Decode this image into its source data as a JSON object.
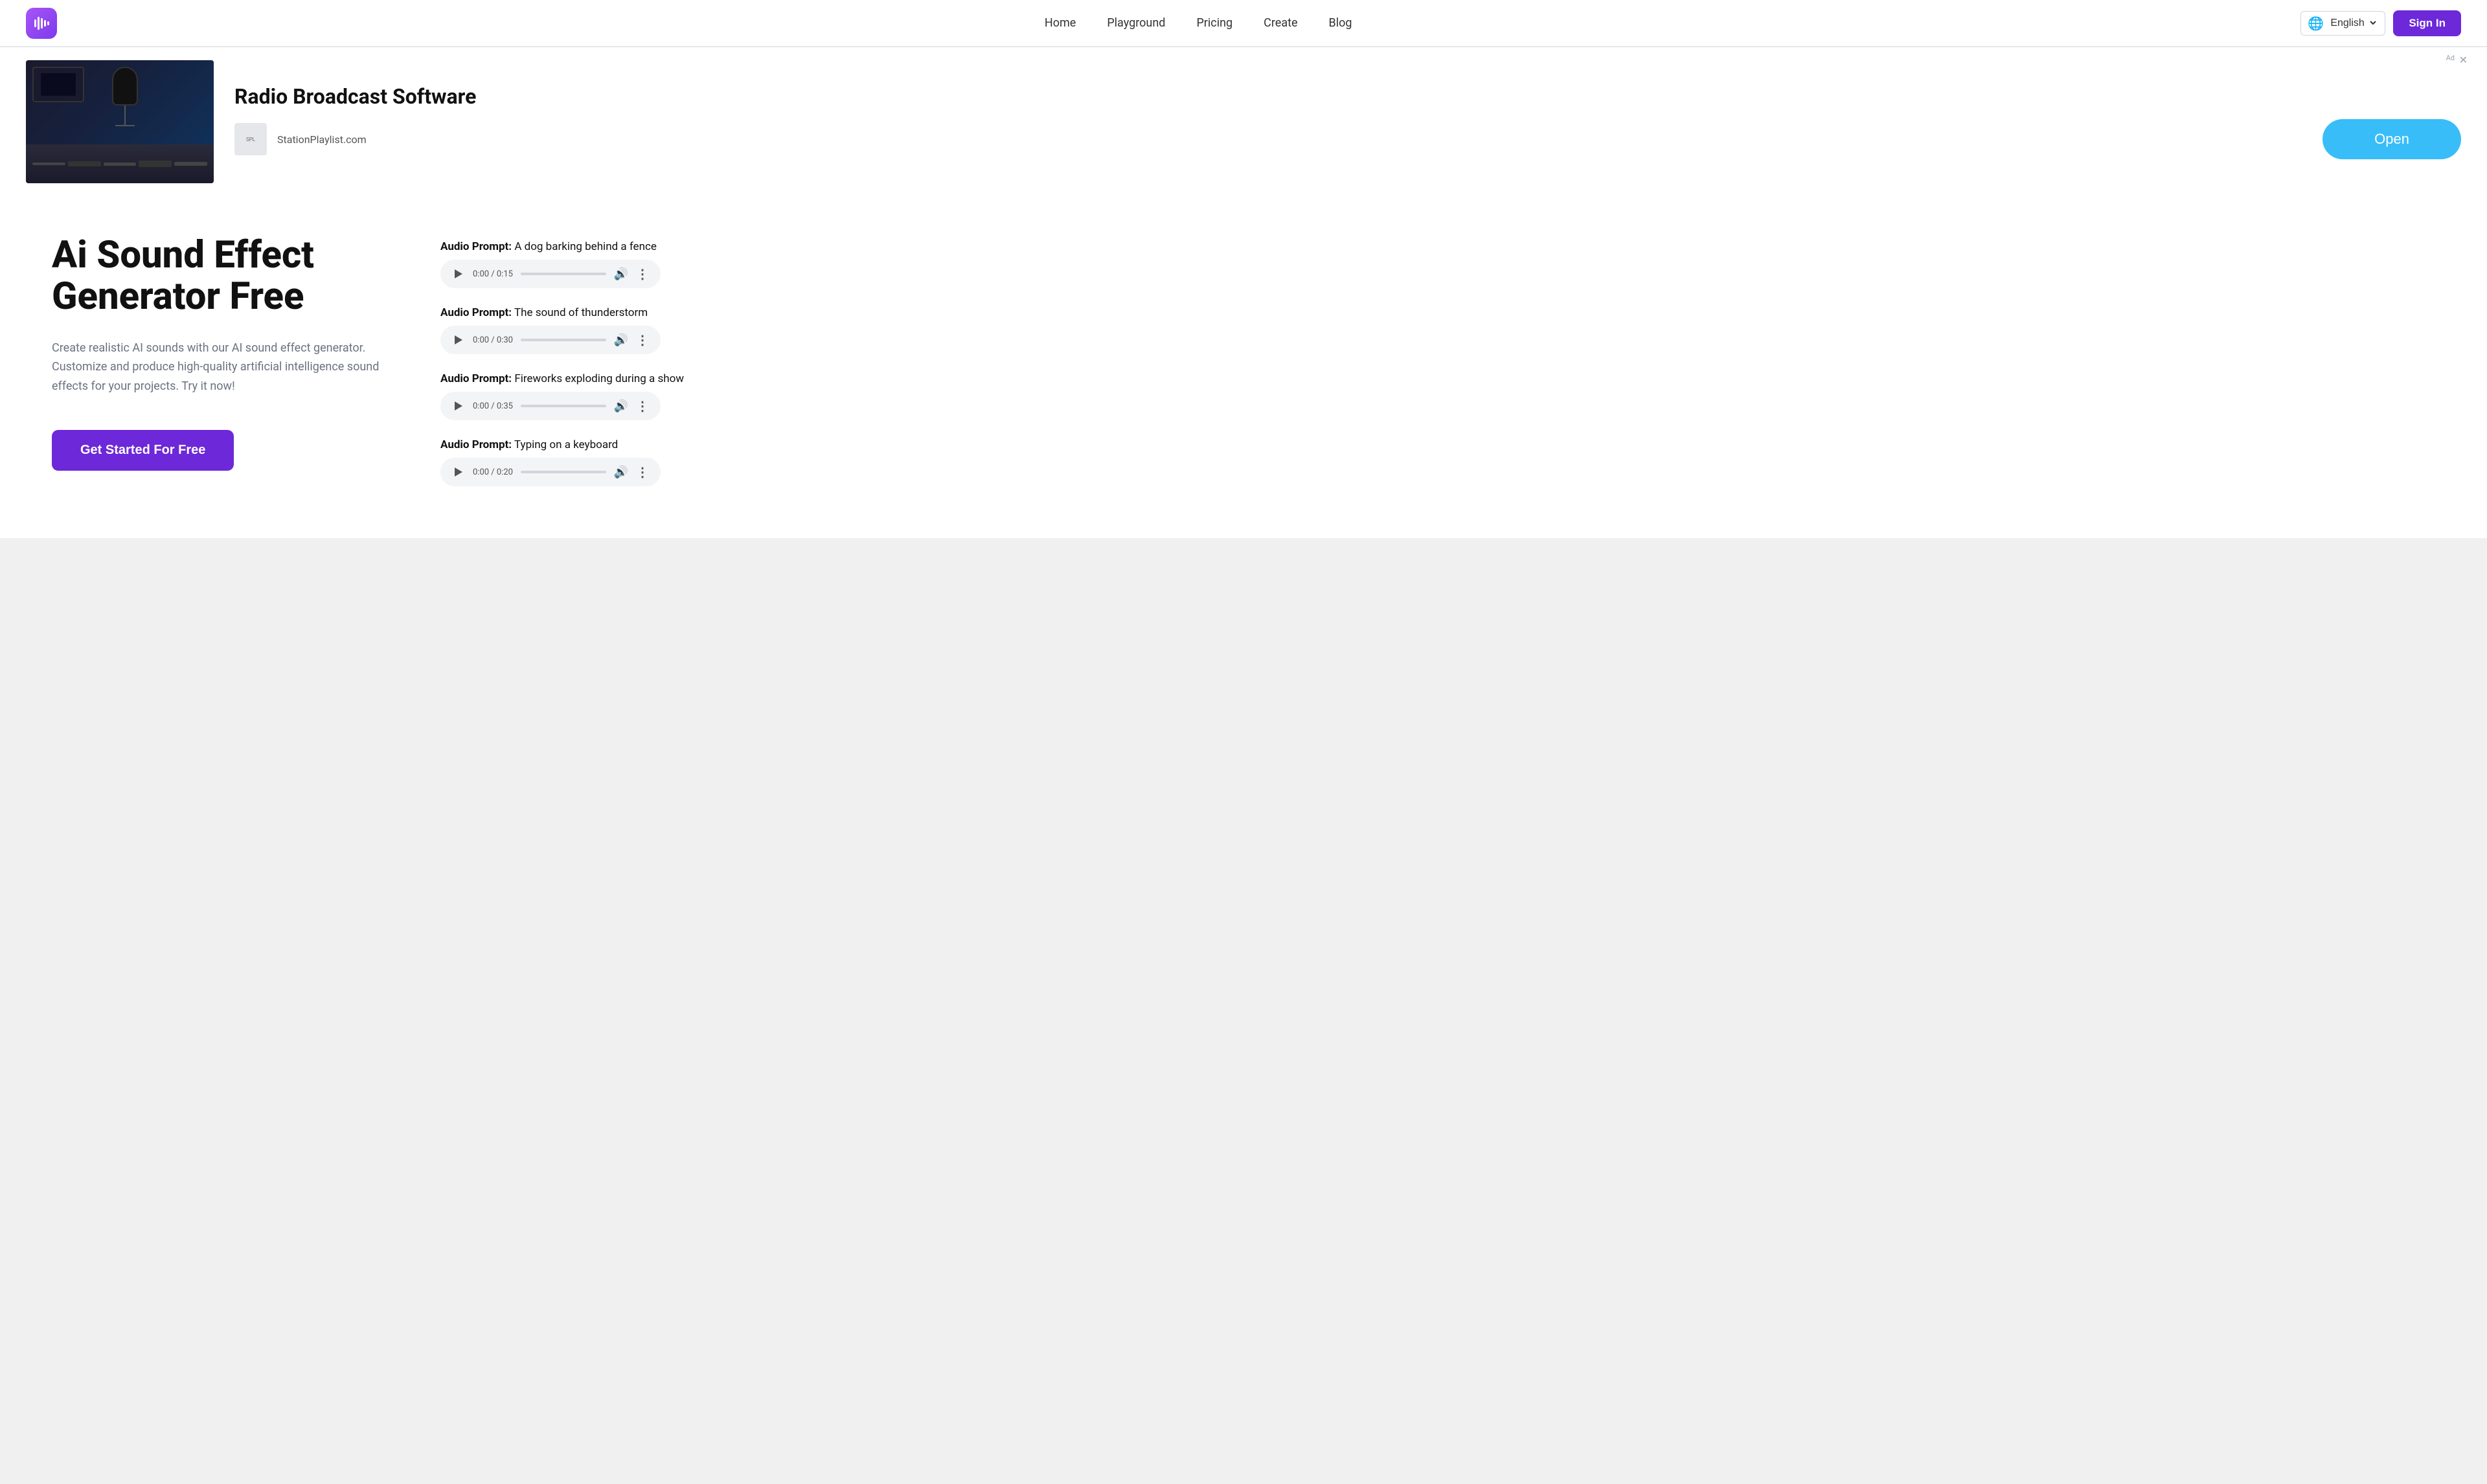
{
  "header": {
    "nav": {
      "home": "Home",
      "playground": "Playground",
      "pricing": "Pricing",
      "create": "Create",
      "blog": "Blog"
    },
    "language": "English",
    "sign_in": "Sign In"
  },
  "ad": {
    "badge": "Ad",
    "title": "Radio Broadcast Software",
    "site": "StationPlaylist.com",
    "cta": "Open"
  },
  "hero": {
    "title": "Ai Sound Effect Generator Free",
    "description": "Create realistic AI sounds with our AI sound effect generator. Customize and produce high-quality artificial intelligence sound effects for your projects. Try it now!",
    "cta": "Get Started For Free"
  },
  "audio_items": [
    {
      "label_prefix": "Audio Prompt:",
      "label_text": "A dog barking behind a fence",
      "time": "0:00 / 0:15"
    },
    {
      "label_prefix": "Audio Prompt:",
      "label_text": "The sound of thunderstorm",
      "time": "0:00 / 0:30"
    },
    {
      "label_prefix": "Audio Prompt:",
      "label_text": "Fireworks exploding during a show",
      "time": "0:00 / 0:35"
    },
    {
      "label_prefix": "Audio Prompt:",
      "label_text": "Typing on a keyboard",
      "time": "0:00 / 0:20"
    }
  ]
}
